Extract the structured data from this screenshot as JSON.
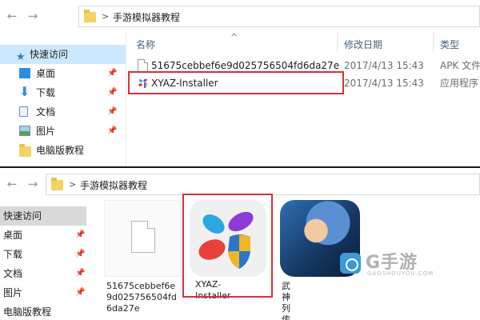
{
  "top": {
    "nav_buttons": {
      "back": "←",
      "forward": "→"
    },
    "breadcrumb": {
      "separator": ">",
      "folder": "手游模拟器教程"
    },
    "columns": {
      "name": "名称",
      "date": "修改日期",
      "type": "类型"
    },
    "sidebar": {
      "items": [
        {
          "label": "快速访问",
          "icon": "star-icon"
        },
        {
          "label": "桌面",
          "icon": "desktop-icon"
        },
        {
          "label": "下载",
          "icon": "download-icon"
        },
        {
          "label": "文档",
          "icon": "document-icon"
        },
        {
          "label": "图片",
          "icon": "picture-icon"
        },
        {
          "label": "电脑版教程",
          "icon": "folder-icon"
        }
      ]
    },
    "files": [
      {
        "name": "51675cebbef6e9d025756504fd6da27e",
        "date": "2017/4/13 15:43",
        "type": "APK 文件"
      },
      {
        "name": "XYAZ-Installer",
        "date": "2017/4/13 15:43",
        "type": "应用程序"
      }
    ]
  },
  "bottom": {
    "nav_buttons": {
      "back": "←",
      "forward": "→"
    },
    "breadcrumb": {
      "separator": ">",
      "folder": "手游模拟器教程"
    },
    "sidebar": {
      "items": [
        {
          "label": "快速访问"
        },
        {
          "label": "桌面"
        },
        {
          "label": "下载"
        },
        {
          "label": "文档"
        },
        {
          "label": "图片"
        },
        {
          "label": "电脑版教程"
        }
      ]
    },
    "tiles": [
      {
        "caption_lines": [
          "51675cebbef6e",
          "9d025756504fd",
          "6da27e"
        ],
        "icon": "generic-file-icon"
      },
      {
        "caption_lines": [
          "XYAZ-Installer"
        ],
        "icon": "xyaz-installer-icon"
      },
      {
        "caption_lines": [
          "武神列传"
        ],
        "icon": "game-app-icon"
      }
    ]
  },
  "watermark": {
    "text": "G手游",
    "sub": "GAOSHOUYOU.COM"
  },
  "colors": {
    "highlight": "#d9313b",
    "quick_access_selected": "#cce8ff",
    "folder": "#f3d35f"
  }
}
